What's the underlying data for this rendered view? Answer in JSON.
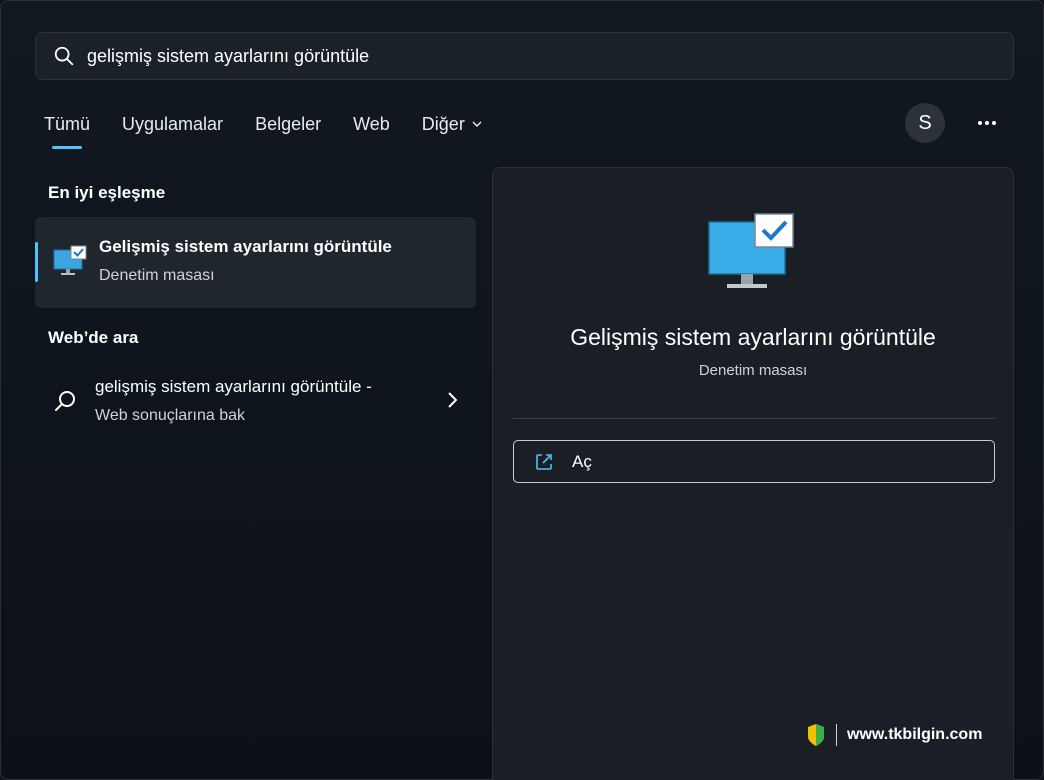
{
  "search": {
    "value": "gelişmiş sistem ayarlarını görüntüle"
  },
  "tabs": [
    {
      "label": "Tümü"
    },
    {
      "label": "Uygulamalar"
    },
    {
      "label": "Belgeler"
    },
    {
      "label": "Web"
    },
    {
      "label": "Diğer"
    }
  ],
  "user": {
    "initial": "S"
  },
  "best_match": {
    "heading": "En iyi eşleşme",
    "title": "Gelişmiş sistem ayarlarını görüntüle",
    "subtitle": "Denetim masası"
  },
  "web_search": {
    "heading": "Web’de ara",
    "title": "gelişmiş sistem ayarlarını görüntüle -",
    "subtitle": "Web sonuçlarına bak"
  },
  "detail": {
    "title": "Gelişmiş sistem ayarlarını görüntüle",
    "subtitle": "Denetim masası",
    "open_label": "Aç"
  },
  "watermark": {
    "text": "www.tkbilgin.com"
  },
  "colors": {
    "accent": "#4cc2ff",
    "background": "#0e131a",
    "panel": "#1a1f26"
  },
  "icons": [
    "search-icon",
    "chevron-down-icon",
    "more-icon",
    "monitor-check-icon",
    "chevron-right-icon",
    "open-external-icon"
  ]
}
